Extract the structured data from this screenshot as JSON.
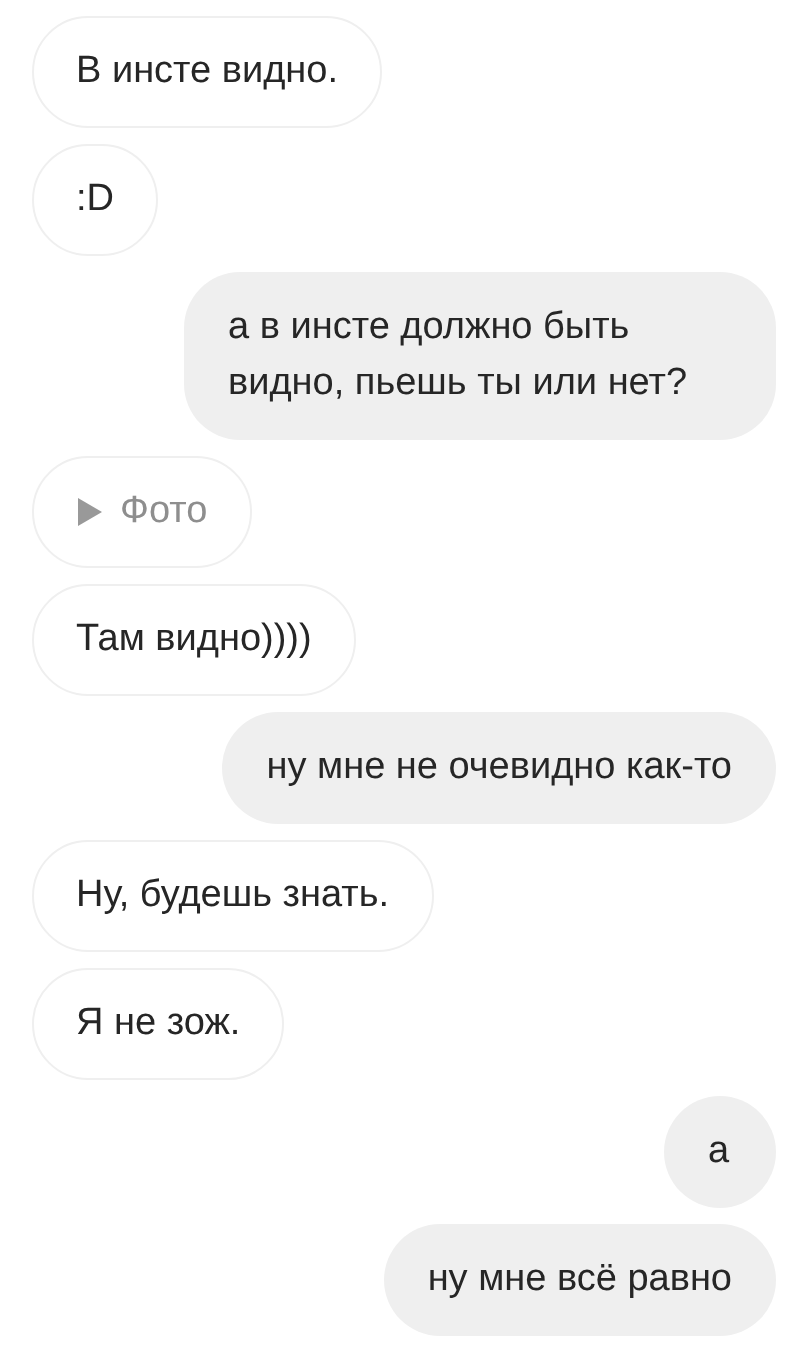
{
  "messages": [
    {
      "kind": "text",
      "outgoing": false,
      "text": "В инсте видно."
    },
    {
      "kind": "text",
      "outgoing": false,
      "text": ":D"
    },
    {
      "kind": "text",
      "outgoing": true,
      "text": "а в инсте должно быть видно, пьешь ты или нет?"
    },
    {
      "kind": "photo",
      "outgoing": false,
      "text": "Фото"
    },
    {
      "kind": "text",
      "outgoing": false,
      "text": "Там видно))))"
    },
    {
      "kind": "text",
      "outgoing": true,
      "text": "ну мне не очевидно как-то"
    },
    {
      "kind": "text",
      "outgoing": false,
      "text": "Ну, будешь знать."
    },
    {
      "kind": "text",
      "outgoing": false,
      "text": "Я не зож."
    },
    {
      "kind": "text",
      "outgoing": true,
      "text": "а"
    },
    {
      "kind": "text",
      "outgoing": true,
      "text": "ну мне всё равно"
    }
  ]
}
